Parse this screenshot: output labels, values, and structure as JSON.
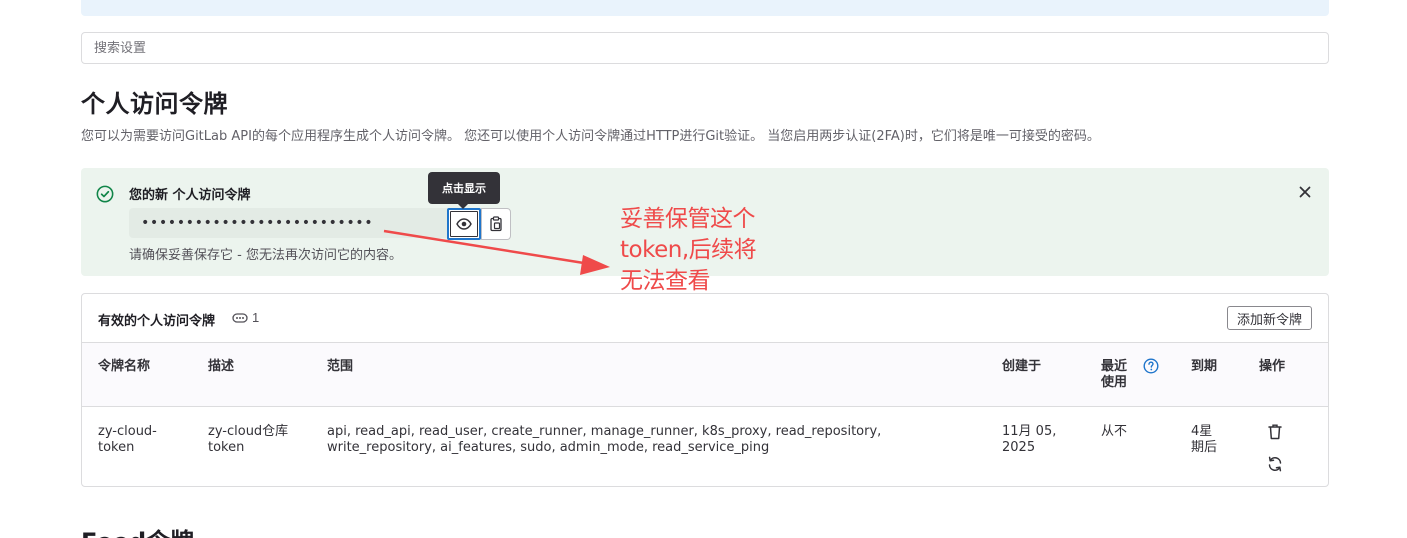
{
  "search": {
    "placeholder": "搜索设置"
  },
  "page": {
    "title": "个人访问令牌",
    "description": "您可以为需要访问GitLab API的每个应用程序生成个人访问令牌。 您还可以使用个人访问令牌通过HTTP进行Git验证。 当您启用两步认证(2FA)时，它们将是唯一可接受的密码。"
  },
  "alert": {
    "title": "您的新 个人访问令牌",
    "token_masked": "••••••••••••••••••••••••••",
    "note": "请确保妥善保存它 - 您无法再次访问它的内容。",
    "tooltip": "点击显示"
  },
  "annotation": {
    "lines": [
      "妥善保管这个",
      "token,后续将",
      "无法查看"
    ],
    "color": "#ef4a4a"
  },
  "tokens_card": {
    "title": "有效的个人访问令牌",
    "count": "1",
    "add_button": "添加新令牌",
    "columns": {
      "name": "令牌名称",
      "description": "描述",
      "scopes": "范围",
      "created": "创建于",
      "last_used_1": "最近",
      "last_used_2": "使用",
      "expires": "到期",
      "actions": "操作"
    },
    "rows": [
      {
        "name_1": "zy-cloud-",
        "name_2": "token",
        "desc_1": "zy-cloud仓库",
        "desc_2": "token",
        "scopes_1": "api, read_api, read_user, create_runner, manage_runner, k8s_proxy, read_repository,",
        "scopes_2": "write_repository, ai_features, sudo, admin_mode, read_service_ping",
        "created_1": "11月 05,",
        "created_2": "2025",
        "last_used": "从不",
        "expires_1": "4星",
        "expires_2": "期后"
      }
    ]
  },
  "feed": {
    "title": "Feed令牌"
  },
  "colors": {
    "accent": "#1f75cb",
    "success": "#108548",
    "alert_bg": "#ecf4ee",
    "banner_bg": "#e9f3fc"
  }
}
